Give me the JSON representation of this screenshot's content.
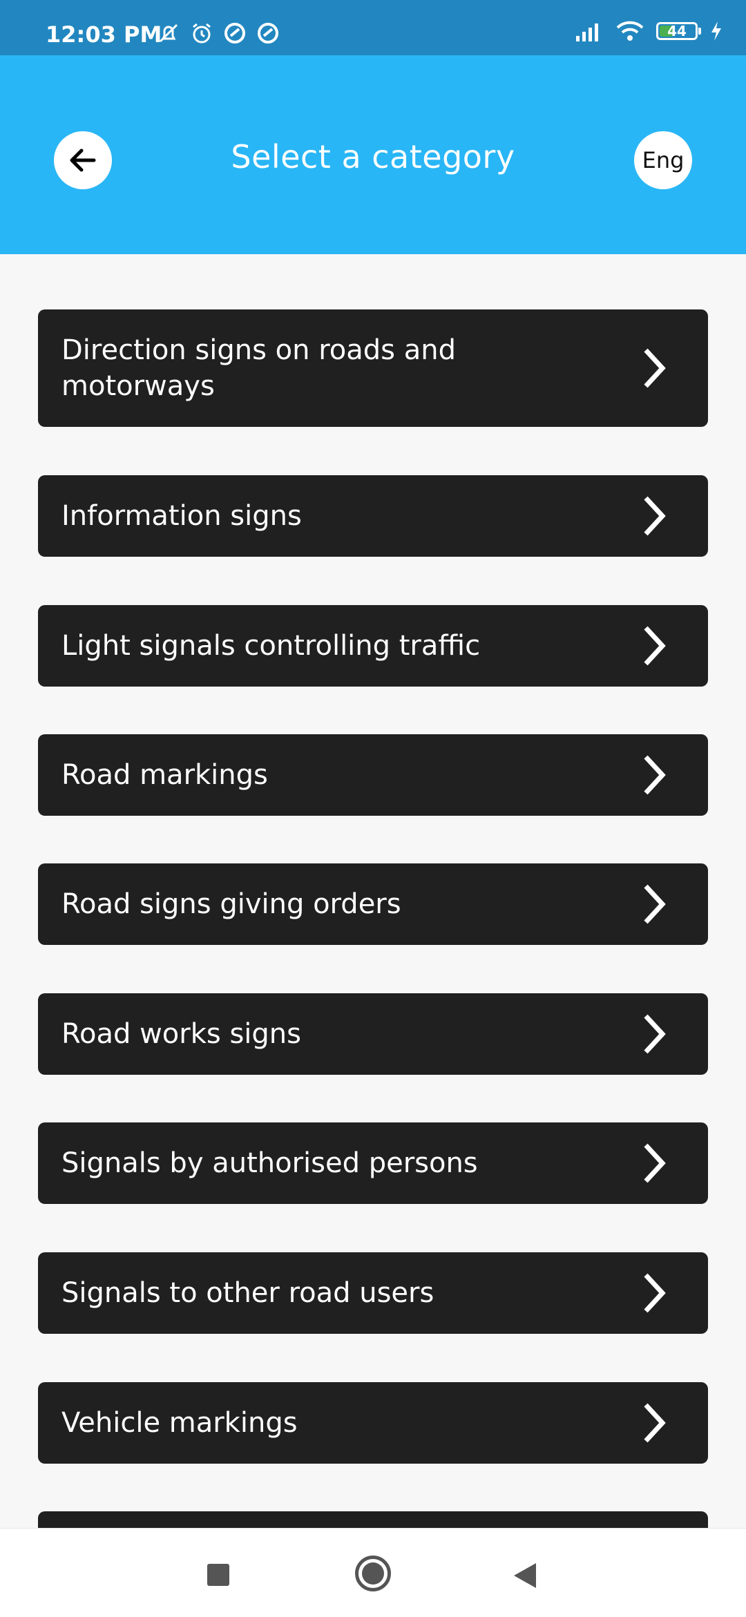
{
  "status_bar": {
    "time": "12:03 PM",
    "left_icons": [
      "notifications-muted-icon",
      "alarm-icon",
      "app-notification-icon",
      "app-notification-icon"
    ],
    "right_icons": [
      "signal-icon",
      "wifi-icon",
      "battery-icon",
      "charging-icon"
    ],
    "battery_level": "44"
  },
  "app_bar": {
    "title": "Select a category",
    "back_icon": "arrow-left-icon",
    "language_label": "Eng",
    "background": "#29b6f6"
  },
  "categories": [
    {
      "label": "Direction signs on roads and motorways"
    },
    {
      "label": "Information signs"
    },
    {
      "label": "Light signals controlling traffic"
    },
    {
      "label": "Road markings"
    },
    {
      "label": "Road signs giving orders"
    },
    {
      "label": "Road works signs"
    },
    {
      "label": "Signals by authorised persons"
    },
    {
      "label": "Signals to other road users"
    },
    {
      "label": "Vehicle markings"
    },
    {
      "label": ""
    }
  ],
  "nav_bar": {
    "icons": [
      "recents-square-icon",
      "home-circle-icon",
      "back-triangle-icon"
    ]
  },
  "colors": {
    "card_background": "#202020",
    "page_background": "#f7f7f7",
    "status_bar": "#2287c0"
  }
}
